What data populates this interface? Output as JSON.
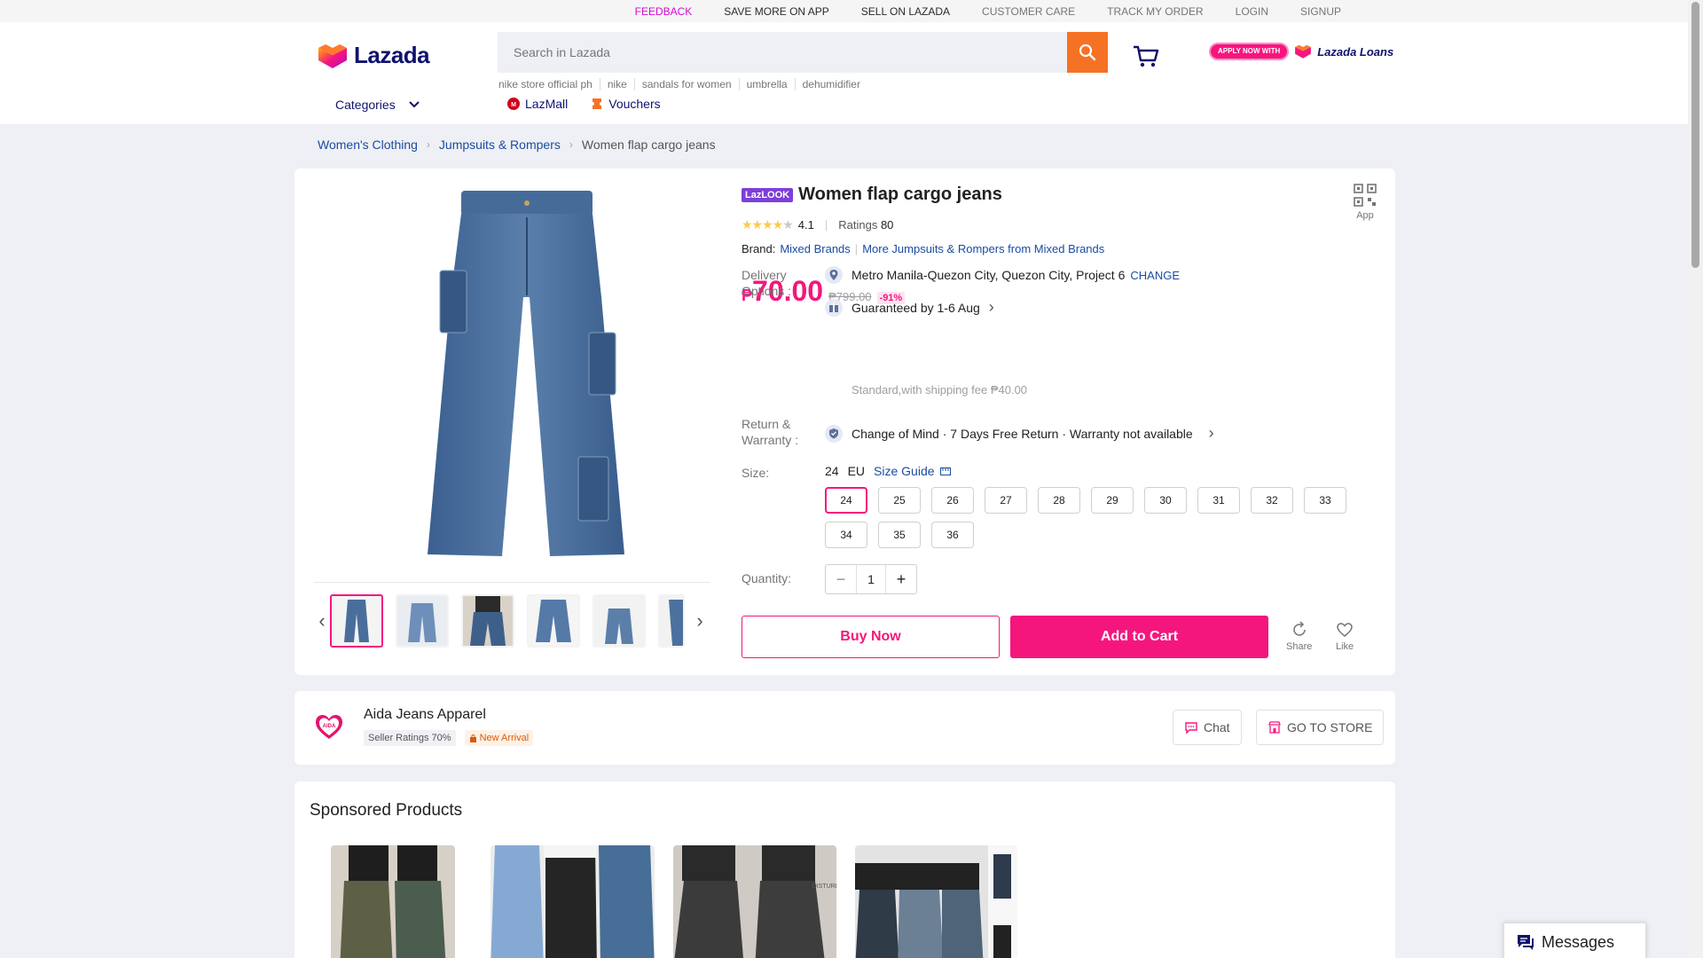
{
  "topbar": {
    "links": [
      {
        "label": "FEEDBACK",
        "style": "feedback"
      },
      {
        "label": "SAVE MORE ON APP",
        "style": "dark"
      },
      {
        "label": "SELL ON LAZADA",
        "style": "dark"
      },
      {
        "label": "CUSTOMER CARE",
        "style": ""
      },
      {
        "label": "TRACK MY ORDER",
        "style": ""
      },
      {
        "label": "LOGIN",
        "style": ""
      },
      {
        "label": "SIGNUP",
        "style": ""
      }
    ]
  },
  "header": {
    "logo_text": "Lazada",
    "search_placeholder": "Search in Lazada",
    "hotwords": [
      "nike store official ph",
      "nike",
      "sandals for women",
      "umbrella",
      "dehumidifier"
    ],
    "apply_now": "APPLY NOW WITH",
    "loans_label": "Lazada Loans",
    "categories_label": "Categories",
    "lazmall_label": "LazMall",
    "vouchers_label": "Vouchers"
  },
  "breadcrumb": {
    "items": [
      "Women's Clothing",
      "Jumpsuits & Rompers"
    ],
    "current": "Women flap cargo jeans"
  },
  "product": {
    "badge": "LazLOOK",
    "title": "Women flap cargo jeans",
    "app_label": "App",
    "rating": "4.1",
    "rating_fraction": 0.82,
    "ratings_label": "Ratings",
    "ratings_count": "80",
    "brand_label": "Brand:",
    "brand_name": "Mixed Brands",
    "brand_sep": "|",
    "brand_more": "More Jumpsuits & Rompers from Mixed Brands",
    "currency": "₱",
    "price": "70.00",
    "old_price": "₱799.00",
    "discount": "-91%",
    "delivery_label_1": "Delivery",
    "delivery_label_2": "Options :",
    "location": "Metro Manila-Quezon City, Quezon City, Project 6",
    "change_label": "CHANGE",
    "guaranteed": "Guaranteed by 1-6 Aug",
    "shipping": "Standard,with shipping fee ₱40.00",
    "return_label_1": "Return &",
    "return_label_2": "Warranty :",
    "return_text": "Change of Mind · 7 Days Free Return · Warranty not available",
    "size_label": "Size:",
    "size_selected": "24",
    "size_unit": "EU",
    "size_guide": "Size Guide",
    "sizes": [
      "24",
      "25",
      "26",
      "27",
      "28",
      "29",
      "30",
      "31",
      "32",
      "33",
      "34",
      "35",
      "36"
    ],
    "quantity_label": "Quantity:",
    "quantity": "1",
    "buy_now": "Buy Now",
    "add_to_cart": "Add to Cart",
    "share_label": "Share",
    "like_label": "Like"
  },
  "seller": {
    "name": "Aida Jeans Apparel",
    "ratings_badge": "Seller Ratings 70%",
    "new_arrival": "New Arrival",
    "chat_label": "Chat",
    "store_label": "GO TO STORE"
  },
  "sponsored": {
    "title": "Sponsored Products"
  },
  "messages": {
    "label": "Messages"
  },
  "colors": {
    "accent": "#f5167d",
    "search_button": "#f57224",
    "link": "#1a4ca0",
    "brand_navy": "#0f136d",
    "badge_purple": "#7d3fd8"
  }
}
